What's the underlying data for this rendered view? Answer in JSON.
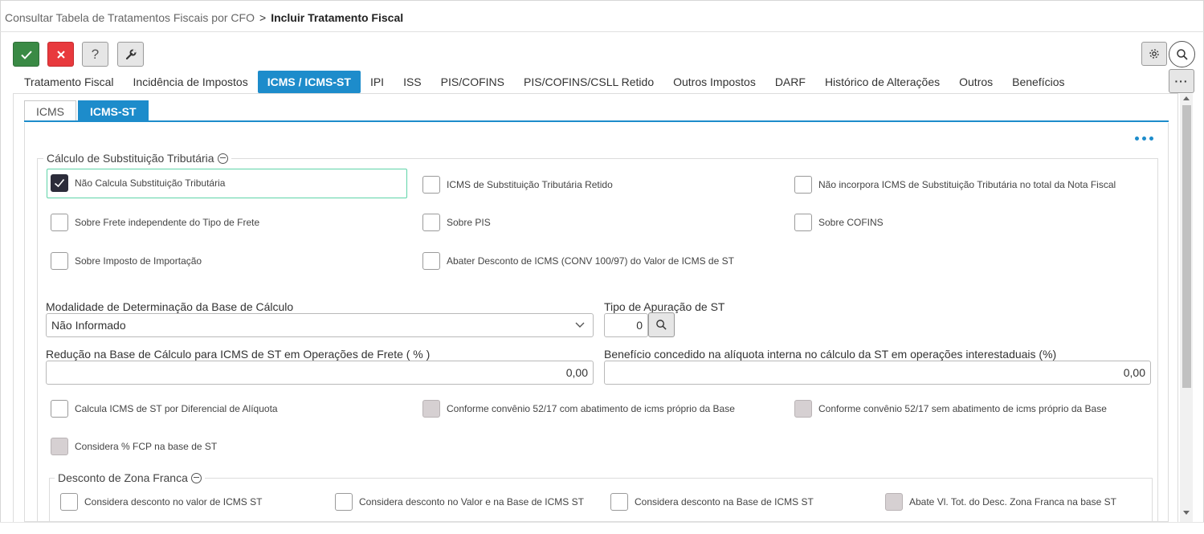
{
  "breadcrumb": {
    "parent": "Consultar Tabela de Tratamentos Fiscais por CFO",
    "separator": ">",
    "current": "Incluir Tratamento Fiscal"
  },
  "toolbar": {
    "help_label": "?",
    "more_label": "···"
  },
  "tabs": [
    {
      "label": "Tratamento Fiscal"
    },
    {
      "label": "Incidência de Impostos"
    },
    {
      "label": "ICMS / ICMS-ST"
    },
    {
      "label": "IPI"
    },
    {
      "label": "ISS"
    },
    {
      "label": "PIS/COFINS"
    },
    {
      "label": "PIS/COFINS/CSLL Retido"
    },
    {
      "label": "Outros Impostos"
    },
    {
      "label": "DARF"
    },
    {
      "label": "Histórico de Alterações"
    },
    {
      "label": "Outros"
    },
    {
      "label": "Benefícios"
    }
  ],
  "active_tab": "ICMS / ICMS-ST",
  "subtabs": [
    {
      "label": "ICMS"
    },
    {
      "label": "ICMS-ST"
    }
  ],
  "active_subtab": "ICMS-ST",
  "calculo": {
    "legend": "Cálculo de Substituição Tributária",
    "checkboxes": [
      {
        "label": "Não Calcula Substituição Tributária",
        "checked": true,
        "disabled": false
      },
      {
        "label": "ICMS de Substituição Tributária Retido",
        "checked": false,
        "disabled": false
      },
      {
        "label": "Não incorpora ICMS de Substituição Tributária no total da Nota Fiscal",
        "checked": false,
        "disabled": false
      },
      {
        "label": "Sobre Frete independente do Tipo de Frete",
        "checked": false,
        "disabled": false
      },
      {
        "label": "Sobre PIS",
        "checked": false,
        "disabled": false
      },
      {
        "label": "Sobre COFINS",
        "checked": false,
        "disabled": false
      },
      {
        "label": "Sobre Imposto de Importação",
        "checked": false,
        "disabled": false
      },
      {
        "label": "Abater Desconto de ICMS (CONV 100/97) do Valor de ICMS de ST",
        "checked": false,
        "disabled": false
      }
    ],
    "modalidade": {
      "label": "Modalidade de Determinação da Base de Cálculo",
      "value": "Não Informado"
    },
    "tipo_apuracao": {
      "label": "Tipo de Apuração de ST",
      "value": "0"
    },
    "reducao": {
      "label": "Redução na Base de Cálculo para ICMS de ST em Operações de Frete ( % )",
      "value": "0,00"
    },
    "beneficio": {
      "label": "Benefício concedido na alíquota interna no cálculo da ST em operações interestaduais (%)",
      "value": "0,00"
    },
    "checkboxes2": [
      {
        "label": "Calcula ICMS de ST por Diferencial de Alíquota",
        "checked": false,
        "disabled": false
      },
      {
        "label": "Conforme convênio 52/17 com abatimento de icms próprio da Base",
        "checked": false,
        "disabled": true
      },
      {
        "label": "Conforme convênio 52/17 sem abatimento de icms próprio da Base",
        "checked": false,
        "disabled": true
      },
      {
        "label": "Considera % FCP na base de ST",
        "checked": false,
        "disabled": true
      }
    ]
  },
  "zona_franca": {
    "legend": "Desconto de Zona Franca",
    "checkboxes": [
      {
        "label": "Considera desconto no valor de ICMS ST",
        "checked": false,
        "disabled": false
      },
      {
        "label": "Considera desconto no Valor e na Base de ICMS ST",
        "checked": false,
        "disabled": false
      },
      {
        "label": "Considera desconto na Base de ICMS ST",
        "checked": false,
        "disabled": false
      },
      {
        "label": "Abate Vl. Tot. do Desc. Zona Franca na base ST",
        "checked": false,
        "disabled": true
      }
    ]
  },
  "colors": {
    "accent": "#1d8ccb",
    "confirm": "#3a8a45",
    "cancel": "#e8393d",
    "focus": "#5ed4a8"
  },
  "icons": [
    "check-icon",
    "close-icon",
    "help-icon",
    "wrench-icon",
    "gear-icon",
    "search-icon",
    "more-icon",
    "minus-circle-icon",
    "chevron-down-icon"
  ]
}
